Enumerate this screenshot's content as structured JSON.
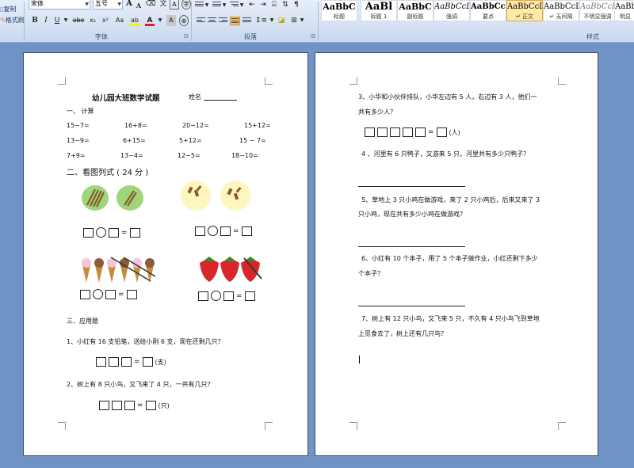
{
  "ribbon": {
    "clipboard": {
      "copy_label": "复制",
      "format_painter_label": "格式刷"
    },
    "font": {
      "font_name": "宋体",
      "font_size": "五号",
      "group_label": "字体",
      "grow_label": "A",
      "shrink_label": "A",
      "bold_label": "B",
      "italic_label": "I",
      "underline_label": "U",
      "strike_label": "abe",
      "subscript_label": "x₂",
      "superscript_label": "x²",
      "case_label": "Aa",
      "font_color_label": "A",
      "char_shading_label": "A",
      "char_border_label": "A"
    },
    "paragraph": {
      "group_label": "段落"
    },
    "styles": {
      "group_label": "样式",
      "items": [
        {
          "preview": "AaBbC",
          "name": "标题"
        },
        {
          "preview": "AaBl",
          "name": "标题 1"
        },
        {
          "preview": "AaBbC",
          "name": "副标题"
        },
        {
          "preview": "AaBbCcDc",
          "name": "强调"
        },
        {
          "preview": "AaBbCcD",
          "name": "要点"
        },
        {
          "preview": "AaBbCcDc",
          "name": "↵ 正文"
        },
        {
          "preview": "AaBbCcDc",
          "name": "↵ 无间隔"
        },
        {
          "preview": "AaBbCcDc",
          "name": "不明显强调"
        },
        {
          "preview": "AaBbCcD",
          "name": "明显"
        }
      ]
    }
  },
  "doc": {
    "page1": {
      "title": "幼儿园大班数学试题",
      "name_label": "姓名",
      "section1": "一、  计算",
      "calc_rows": [
        [
          "15−7=",
          "16+8=",
          "20−12=",
          "15+12="
        ],
        [
          "13−9=",
          "6+15=",
          "5+12=",
          "15 − 7="
        ],
        [
          "7+9=",
          "13−4=",
          "12−5=",
          "18−10="
        ]
      ],
      "section2": "二、看图列式 ( 24 分 )",
      "section3": "三．应用题",
      "q1": "1、小红有 16 支铅笔，送给小刚 6 支，现在还剩几只？",
      "q1_unit": "(支)",
      "q2": "2、树上有 8 只小鸟，又飞来了 4 只，一共有几只？",
      "q2_unit": "(只)"
    },
    "page2": {
      "q3_line1": "3、小华和小伙伴排队，小华左边有 5 人，右边有 3 人，他们一",
      "q3_line2": "共有多少人？",
      "q3_unit": "(人)",
      "q4": "4 、河里有 6 只鸭子，又游来 5 只，河里共有多少只鸭子？",
      "q5_line1": "5、草地上 3 只小鸡在做游戏，来了 2 只小鸡后，后来又来了 3",
      "q5_line2": "只小鸡，现在共有多少小鸡在做游戏？",
      "q6_line1": "6、小红有 10 个本子，用了 5 个本子做作业，小红还剩下多少",
      "q6_line2": "个本子？",
      "q7_line1": "7、树上有 12 只小鸟，又飞来 5 只，不久有 4 只小鸟飞到草地",
      "q7_line2": "上觅食去了，树上还有几只鸟？"
    },
    "operators": {
      "equals": "="
    }
  },
  "colors": {
    "workspace": "#6f93c4",
    "highlight_yellow": "#ffee00",
    "font_red": "#e02020",
    "selected_style": "#fde9a8"
  }
}
